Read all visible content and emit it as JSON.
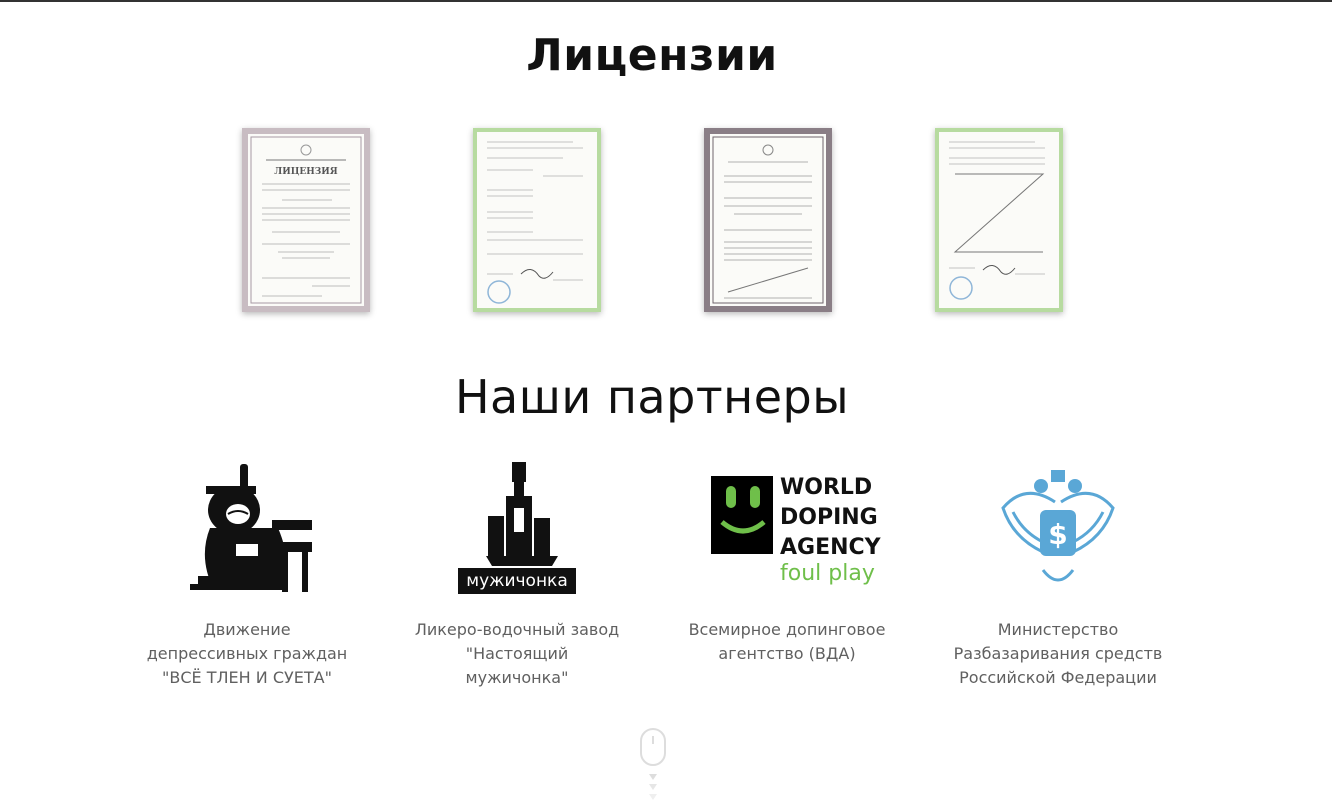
{
  "licenses": {
    "title": "Лицензии",
    "docs": [
      {
        "heading": "ЛИЦЕНЗИЯ",
        "style": "ornate"
      },
      {
        "style": "green"
      },
      {
        "style": "dark-ornate"
      },
      {
        "style": "green-blank"
      }
    ]
  },
  "partners": {
    "title": "Наши партнеры",
    "items": [
      {
        "caption": "Движение депрессивных граждан  \"ВСЁ ТЛЕН И СУЕТА\"",
        "icon": "sad-man-icon"
      },
      {
        "caption": "Ликеро-водочный завод \"Настоящий мужичонка\"",
        "icon": "bottle-logo-icon",
        "logo_text": "мужичонка"
      },
      {
        "caption": "Всемирное допинговое агентство (ВДА)",
        "icon": "wada-logo-icon",
        "logo_lines": [
          "WORLD",
          "DOPING",
          "AGENCY"
        ],
        "logo_sub": "foul play"
      },
      {
        "caption": "Министерство Разбазаривания  средств Российской Федерации",
        "icon": "eagle-emblem-icon"
      }
    ]
  },
  "colors": {
    "title": "#111111",
    "caption": "#606060",
    "wada_green": "#6fbf4a",
    "emblem_blue": "#5aa7d6",
    "frame_green": "#b7dba0",
    "frame_ornate": "#b9aeb4"
  }
}
